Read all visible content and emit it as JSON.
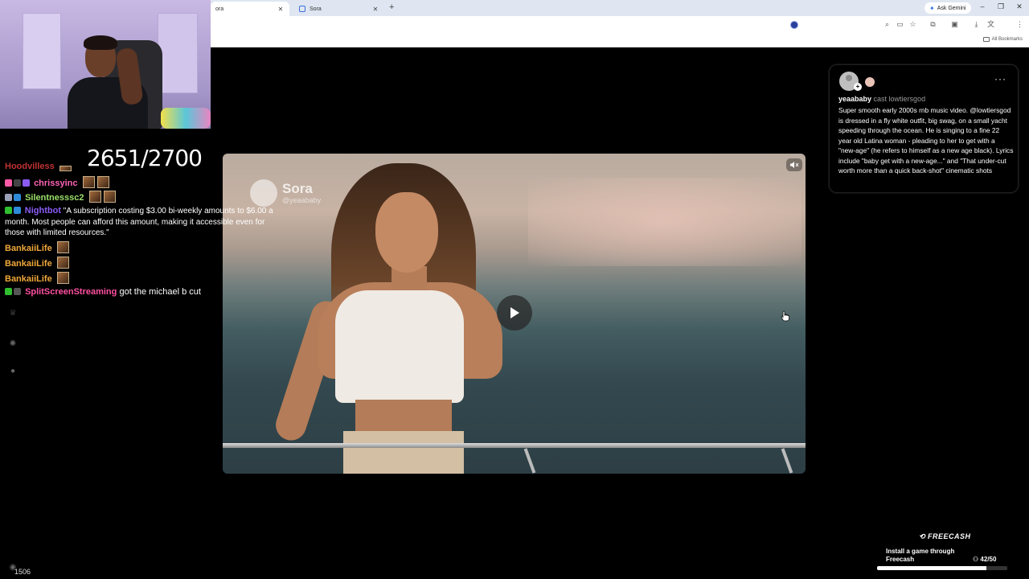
{
  "browser": {
    "tabs": [
      {
        "title": "ora",
        "active": true
      },
      {
        "title": "Sora",
        "active": false
      }
    ],
    "new_tab": "+",
    "gemini_label": "Ask Gemini",
    "bookmarks_label": "All Bookmarks",
    "window_controls": [
      "–",
      "❐",
      "✕"
    ]
  },
  "stream": {
    "counter": "2651/2700",
    "viewers": "1506"
  },
  "chat": {
    "lines": [
      {
        "user": "Hoodvilless",
        "color": "#e23b3b",
        "msg": ""
      },
      {
        "user": "chrissyinc",
        "color": "#ff63b6",
        "msg": ""
      },
      {
        "user": "Silentnesssc2",
        "color": "#9be06a",
        "msg": ""
      },
      {
        "user": "Nightbot",
        "color": "#7b5cf0",
        "msg": "\"A subscription costing $3.00 bi-weekly amounts to $6.00 a month. Most people can afford this amount, making it accessible even for those with limited resources.\""
      },
      {
        "user": "BankaiiLife",
        "color": "#f0a83a",
        "msg": ""
      },
      {
        "user": "BankaiiLife",
        "color": "#f0a83a",
        "msg": ""
      },
      {
        "user": "BankaiiLife",
        "color": "#f0a83a",
        "msg": ""
      },
      {
        "user": "SplitScreenStreaming",
        "color": "#ff4fa0",
        "msg": "got the michael b cut"
      }
    ]
  },
  "video": {
    "watermark_name": "Sora",
    "watermark_handle": "@yeaababy"
  },
  "post": {
    "author": "yeaababy",
    "cast_text": "cast lowtiersgod",
    "more": "···",
    "description": "Super smooth early 2000s rnb music video. @lowtiersgod is dressed in a fly white outfit, big swag, on a small yacht speeding through the ocean. He is singing to a fine 22 year old Latina woman - pleading to her to get with a \"new-age\" (he refers to himself as a new age black). Lyrics include \"baby get with a new-age...\" and \"That under-cut worth more than a quick back-shot\" cinematic shots"
  },
  "freecash": {
    "logo": "FREECASH",
    "text": "Install a game through Freecash",
    "count": "42/50",
    "progress": 0.84
  }
}
